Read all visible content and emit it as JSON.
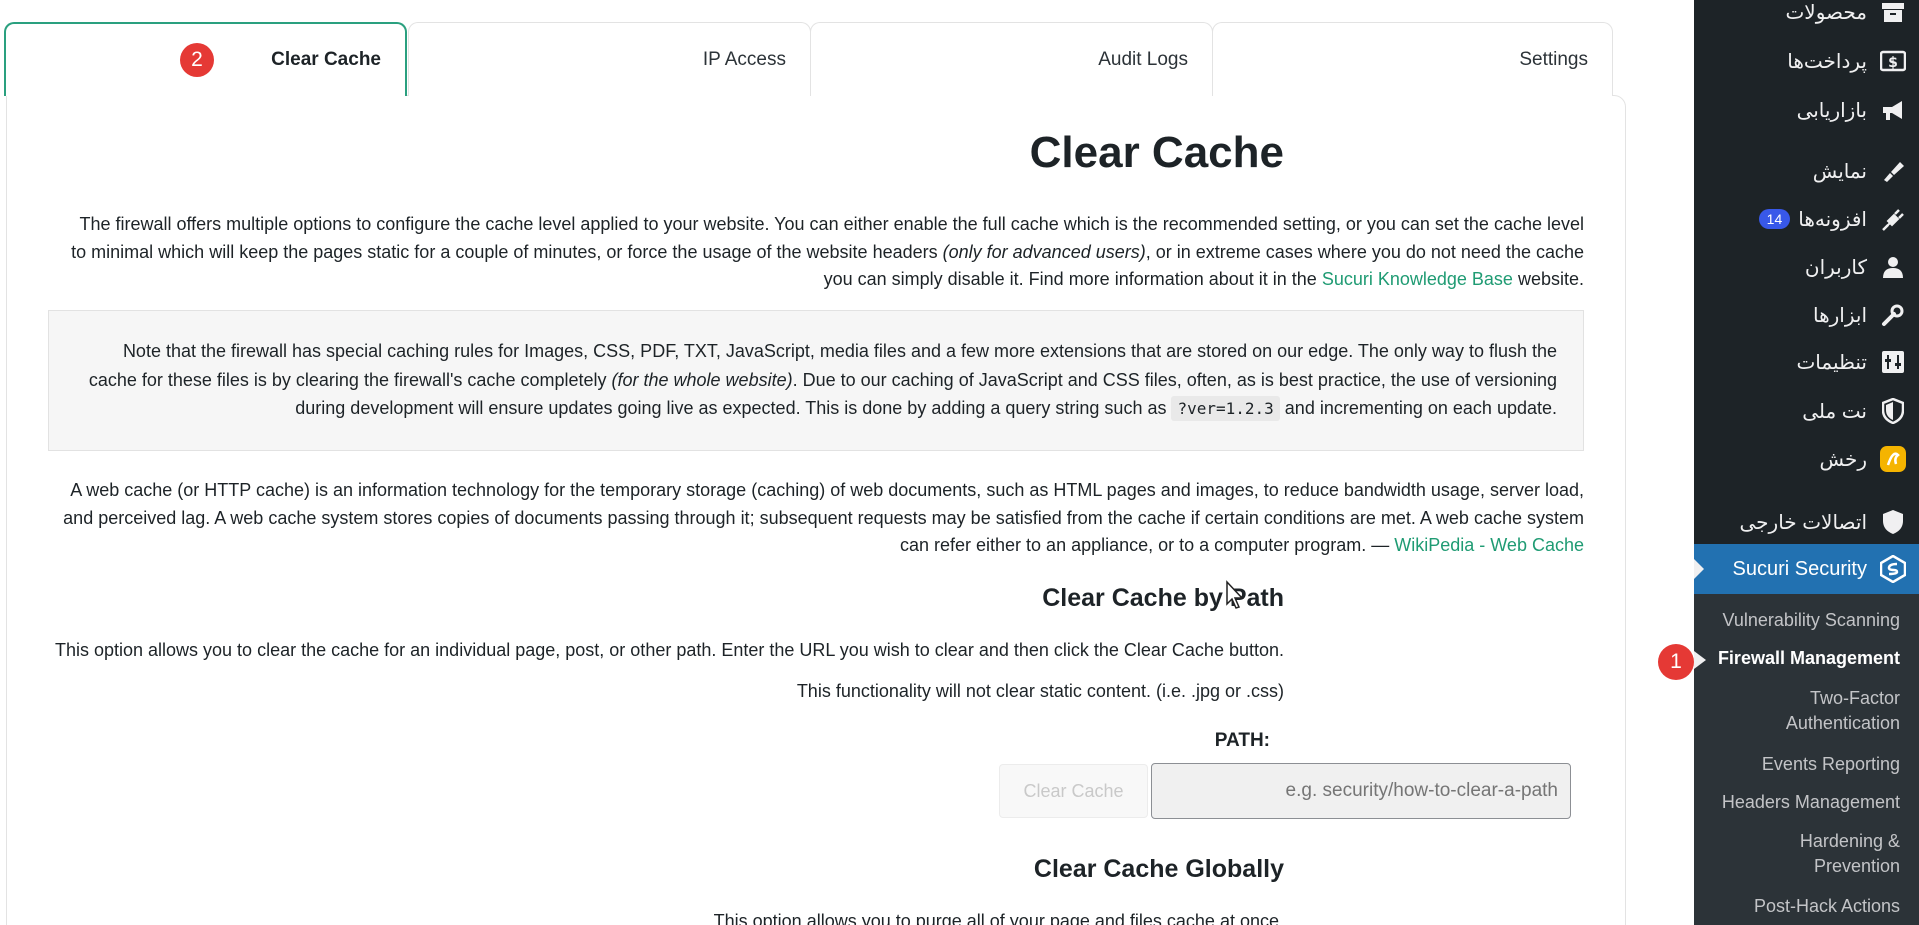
{
  "tabs": [
    {
      "label": "Clear Cache",
      "badge": "2",
      "active": true
    },
    {
      "label": "IP Access"
    },
    {
      "label": "Audit Logs"
    },
    {
      "label": "Settings"
    }
  ],
  "content": {
    "title": "Clear Cache",
    "intro": {
      "part1": "The firewall offers multiple options to configure the cache level applied to your website. You can either enable the full cache which is the recommended setting, or you can set the cache level to minimal which will keep the pages static for a couple of minutes, or force the usage of the website headers ",
      "italic": "(only for advanced users)",
      "part2": ", or in extreme cases where you do not need the cache you can simply disable it. Find more information about it in the ",
      "link": "Sucuri Knowledge Base",
      "part3": " website."
    },
    "note": {
      "part1": "Note that the firewall has special caching rules for Images, CSS, PDF, TXT, JavaScript, media files and a few more extensions that are stored on our edge. The only way to flush the cache for these files is by clearing the firewall's cache completely ",
      "italic": "(for the whole website)",
      "part2": ". Due to our caching of JavaScript and CSS files, often, as is best practice, the use of versioning during development will ensure updates going live as expected. This is done by adding a query string such as ",
      "code": "?ver=1.2.3",
      "part3": " and incrementing on each update."
    },
    "definition": {
      "text": "A web cache (or HTTP cache) is an information technology for the temporary storage (caching) of web documents, such as HTML pages and images, to reduce bandwidth usage, server load, and perceived lag. A web cache system stores copies of documents passing through it; subsequent requests may be satisfied from the cache if certain conditions are met. A web cache system can refer either to an appliance, or to a computer program. — ",
      "link": "WikiPedia - Web Cache"
    },
    "by_path": {
      "title": "Clear Cache by Path",
      "description": "This option allows you to clear the cache for an individual page, post, or other path. Enter the URL you wish to clear and then click the Clear Cache button.",
      "note": "This functionality will not clear static content. (i.e. .jpg or .css)",
      "path_label": "PATH:",
      "input_placeholder": "e.g. security/how-to-clear-a-path",
      "input_value": "",
      "button_label": "Clear Cache"
    },
    "globally": {
      "title": "Clear Cache Globally",
      "description": "This option allows you to purge all of your page and files cache at once."
    }
  },
  "sidebar": {
    "items": [
      {
        "label": "محصولات",
        "icon": "archive-icon"
      },
      {
        "label": "پرداخت‌ها",
        "icon": "dollar-icon"
      },
      {
        "label": "بازاریابی",
        "icon": "megaphone-icon"
      },
      {
        "label": "نمایش",
        "icon": "brush-icon"
      },
      {
        "label": "افزونه‌ها",
        "icon": "plugin-icon",
        "badge": "14"
      },
      {
        "label": "کاربران",
        "icon": "user-icon"
      },
      {
        "label": "ابزارها",
        "icon": "wrench-icon"
      },
      {
        "label": "تنظیمات",
        "icon": "settings-icon"
      },
      {
        "label": "نت ملی",
        "icon": "shield-icon"
      },
      {
        "label": "رخش",
        "icon": "rakhsh-icon"
      },
      {
        "label": "اتصالات خارجی",
        "icon": "shield-icon"
      },
      {
        "label": "Sucuri Security",
        "icon": "sucuri-icon",
        "current": true
      }
    ],
    "submenu": [
      {
        "label": "Vulnerability Scanning"
      },
      {
        "label": "Firewall Management",
        "active": true,
        "badge": "1"
      },
      {
        "label": "Two-Factor Authentication"
      },
      {
        "label": "Events Reporting"
      },
      {
        "label": "Headers Management"
      },
      {
        "label": "Hardening & Prevention"
      },
      {
        "label": "Post-Hack Actions"
      }
    ]
  },
  "colors": {
    "accent": "#2aa07f",
    "link": "#1f9b73",
    "sidebar_bg": "#1d2327",
    "sidebar_current": "#2271b1",
    "badge_red": "#e53935"
  }
}
